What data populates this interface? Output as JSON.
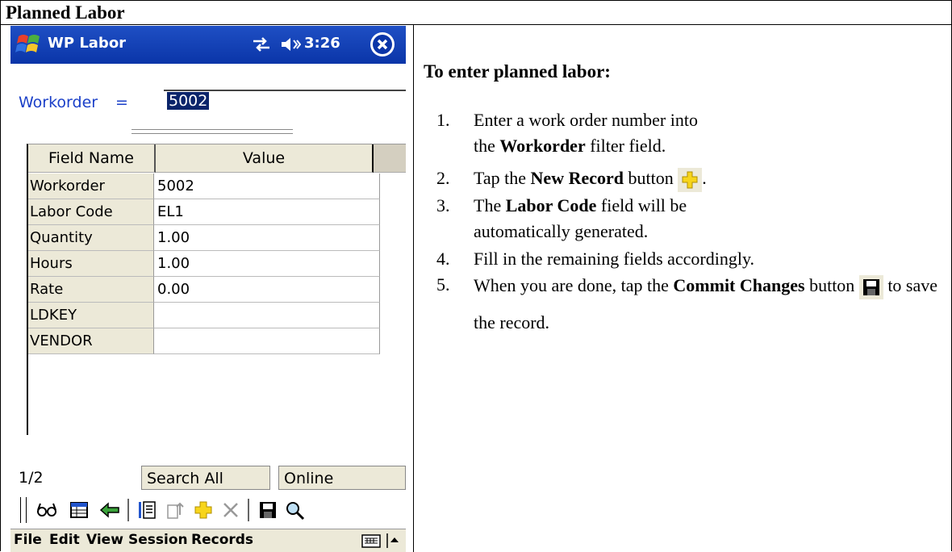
{
  "document": {
    "section_title": "Planned Labor"
  },
  "pda": {
    "app_title": "WP Labor",
    "clock": "3:26",
    "filter": {
      "label": "Workorder",
      "operator": "=",
      "value": "5002"
    },
    "grid": {
      "columns": [
        "Field Name",
        "Value"
      ],
      "rows": [
        {
          "name": "Workorder",
          "value": "5002"
        },
        {
          "name": "Labor Code",
          "value": "EL1"
        },
        {
          "name": "Quantity",
          "value": "1.00"
        },
        {
          "name": "Hours",
          "value": "1.00"
        },
        {
          "name": "Rate",
          "value": "0.00"
        },
        {
          "name": "LDKEY",
          "value": ""
        },
        {
          "name": "VENDOR",
          "value": ""
        }
      ]
    },
    "status": {
      "page": "1/2",
      "search": "Search All",
      "connection": "Online"
    },
    "toolbar": {
      "icons": [
        "view-icon",
        "grid-icon",
        "back-arrow-icon",
        "list-icon",
        "export-icon",
        "new-record-icon",
        "delete-icon",
        "save-icon",
        "search-icon"
      ]
    },
    "menu": [
      "File",
      "Edit",
      "View",
      "Session",
      "Records"
    ]
  },
  "instructions": {
    "heading": "To enter planned labor:",
    "steps": [
      {
        "num": "1.",
        "pre": "Enter a work order number into the ",
        "bold": "Workorder",
        "post": " filter field."
      },
      {
        "num": "2.",
        "pre": "Tap the ",
        "bold": "New Record",
        "post": " button"
      },
      {
        "num": "3.",
        "pre": "The ",
        "bold": "Labor Code",
        "post": " field will be automatically generated."
      },
      {
        "num": "4.",
        "pre": "Fill in the remaining fields accordingly.",
        "bold": "",
        "post": ""
      },
      {
        "num": "5.",
        "pre": "When you are done, tap the ",
        "bold": "Commit Changes",
        "post": " button  to save the record."
      }
    ]
  },
  "colors": {
    "taskbar": "#0a35a8",
    "filter_text": "#1a3fc8",
    "selection": "#0a246a",
    "grid_header": "#ece9d8"
  }
}
